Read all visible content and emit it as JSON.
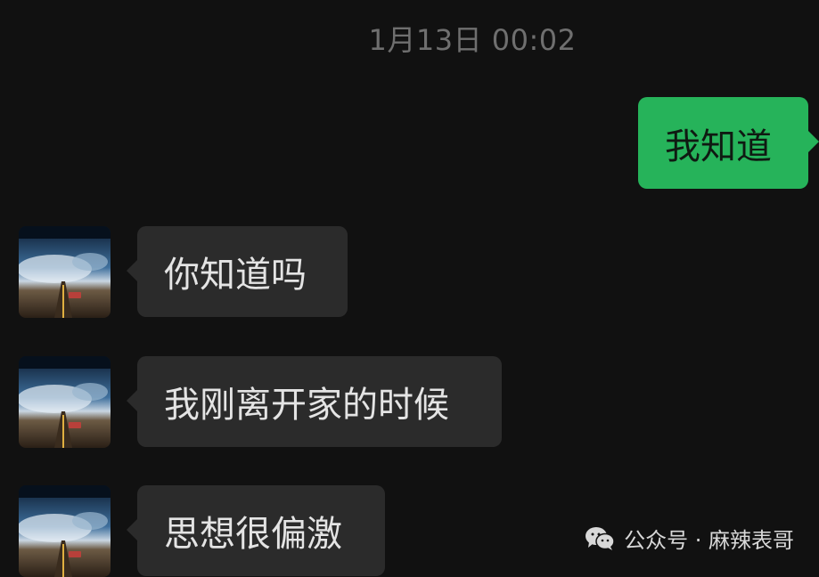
{
  "chat": {
    "timestamp": "1月13日 00:02",
    "messages": [
      {
        "side": "sent",
        "text": "我知道"
      },
      {
        "side": "received",
        "text": "你知道吗"
      },
      {
        "side": "received",
        "text": "我刚离开家的时候"
      },
      {
        "side": "received",
        "text": "思想很偏激"
      }
    ],
    "avatar_icon": "earth-road-avatar-icon"
  },
  "watermark": {
    "icon": "wechat-icon",
    "text": "公众号 · 麻辣表哥"
  },
  "colors": {
    "background": "#111111",
    "sent_bubble": "#26b35a",
    "received_bubble": "#2b2b2b",
    "timestamp": "#6f6f6f"
  }
}
